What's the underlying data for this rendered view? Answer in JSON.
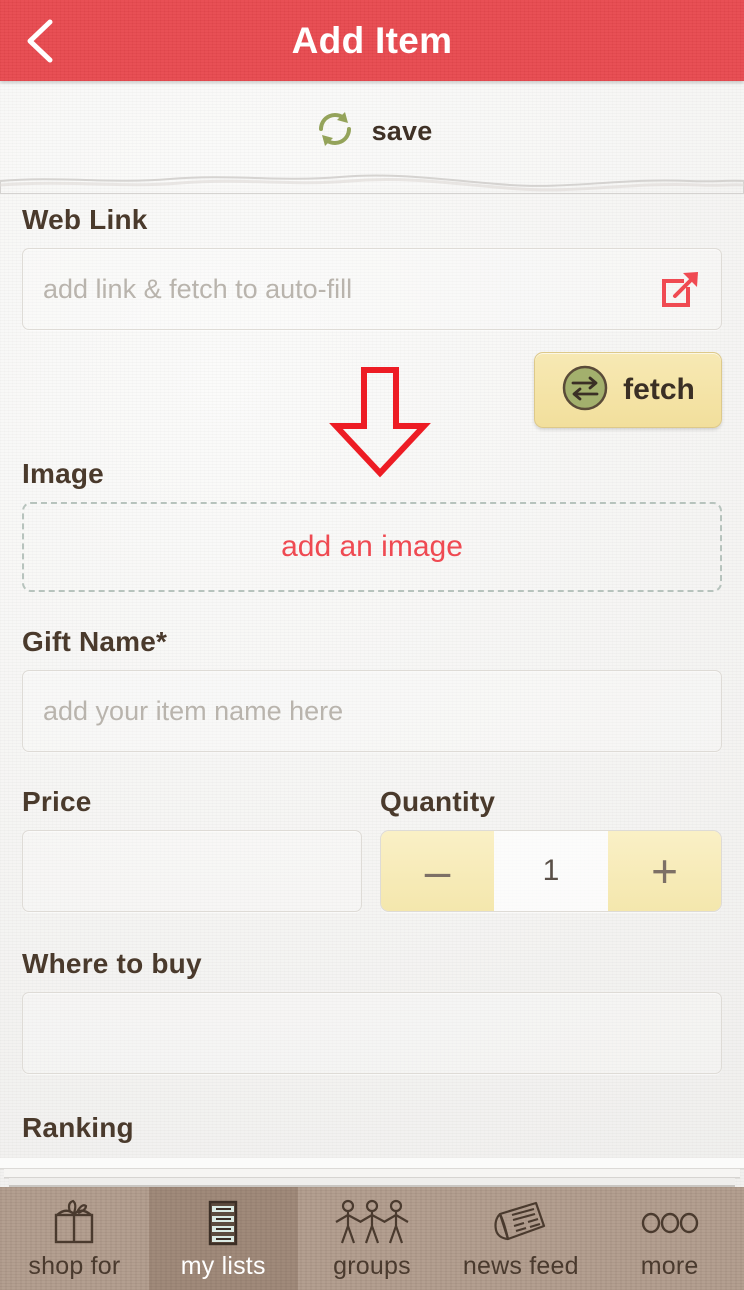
{
  "header": {
    "title": "Add Item",
    "back_icon": "chevron-left-icon",
    "background_color": "#e8494f"
  },
  "save_bar": {
    "label": "save",
    "icon": "sync-arrows-icon",
    "icon_color": "#94a35a"
  },
  "form": {
    "web_link": {
      "label": "Web Link",
      "value": "",
      "placeholder": "add link & fetch to auto-fill",
      "action_icon": "external-link-icon",
      "action_icon_color": "#f04a52"
    },
    "fetch": {
      "label": "fetch",
      "icon": "swap-arrows-icon",
      "icon_color": "#a3b06d",
      "background_color": "#f4e3a0"
    },
    "image": {
      "label": "Image",
      "dropzone_text": "add an image",
      "dropzone_text_color": "#ef4a52"
    },
    "gift_name": {
      "label": "Gift Name*",
      "value": "",
      "placeholder": "add your item name here"
    },
    "price": {
      "label": "Price",
      "value": "",
      "placeholder": ""
    },
    "quantity": {
      "label": "Quantity",
      "value": "1",
      "decrement_label": "–",
      "increment_label": "+"
    },
    "where_to_buy": {
      "label": "Where to buy",
      "value": "",
      "placeholder": ""
    },
    "ranking": {
      "label": "Ranking"
    }
  },
  "annotation": {
    "type": "down-arrow",
    "color": "#ed1c24"
  },
  "tab_bar": {
    "selected_index": 1,
    "background_color": "#b09b8b",
    "items": [
      {
        "label": "shop for",
        "icon": "gift-box-icon"
      },
      {
        "label": "my lists",
        "icon": "checklist-icon"
      },
      {
        "label": "groups",
        "icon": "people-group-icon"
      },
      {
        "label": "news feed",
        "icon": "newspaper-icon"
      },
      {
        "label": "more",
        "icon": "ellipsis-icon"
      }
    ]
  }
}
